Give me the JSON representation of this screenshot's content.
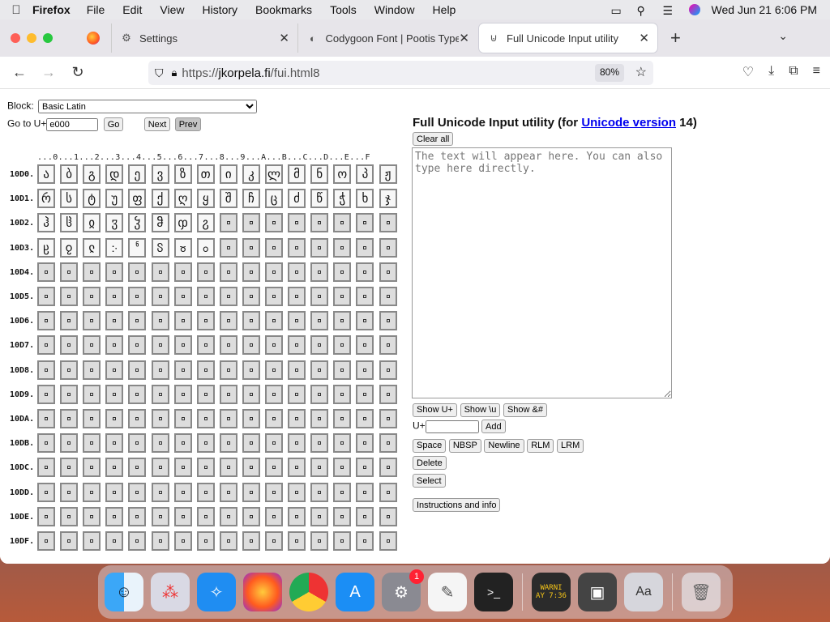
{
  "menubar": {
    "app_name": "Firefox",
    "items": [
      "File",
      "Edit",
      "View",
      "History",
      "Bookmarks",
      "Tools",
      "Window",
      "Help"
    ],
    "clock": "Wed Jun 21  6:06 PM"
  },
  "tabs": [
    {
      "title": "Settings",
      "icon": "gear-icon"
    },
    {
      "title": "Codygoon Font | Pootis Type Co",
      "icon": "codygoon-favicon"
    },
    {
      "title": "Full Unicode Input utility",
      "icon": "page-icon"
    }
  ],
  "urlbar": {
    "prefix": "https://",
    "host": "jkorpela.fi",
    "path": "/fui.html8",
    "zoom": "80%"
  },
  "page": {
    "block_label": "Block:",
    "block_value": "Basic Latin",
    "goto_label": "Go to U+",
    "goto_value": "e000",
    "go_label": "Go",
    "next_label": "Next",
    "prev_label": "Prev",
    "grid_header": "...0...1...2...3...4...5...6...7...8...9...A...B...C...D...E...F",
    "row_labels": [
      "10D0.",
      "10D1.",
      "10D2.",
      "10D3.",
      "10D4.",
      "10D5.",
      "10D6.",
      "10D7.",
      "10D8.",
      "10D9.",
      "10DA.",
      "10DB.",
      "10DC.",
      "10DD.",
      "10DE.",
      "10DF."
    ],
    "glyph_rows": [
      [
        "ა",
        "ბ",
        "გ",
        "დ",
        "ე",
        "ვ",
        "ზ",
        "თ",
        "ი",
        "კ",
        "ლ",
        "მ",
        "ნ",
        "ო",
        "პ",
        "ჟ"
      ],
      [
        "რ",
        "ს",
        "ტ",
        "უ",
        "ფ",
        "ქ",
        "ღ",
        "ყ",
        "შ",
        "ჩ",
        "ც",
        "ძ",
        "წ",
        "ჭ",
        "ხ",
        "ჯ"
      ],
      [
        "ჰ",
        "ჱ",
        "ჲ",
        "ჳ",
        "ჴ",
        "ჵ",
        "ჶ",
        "ჷ",
        "",
        "",
        "",
        "",
        "",
        "",
        "",
        ""
      ],
      [
        "ჸ",
        "ჹ",
        "ჺ",
        "჻",
        "ჼ",
        "ჽ",
        "ჾ",
        "ჿ",
        "",
        "",
        "",
        "",
        "",
        "",
        "",
        ""
      ]
    ],
    "title_prefix": "Full Unicode Input utility (for ",
    "title_link": "Unicode version",
    "title_suffix": " 14)",
    "clear_label": "Clear all",
    "textarea_placeholder": "The text will appear here. You can also type here directly.",
    "show_uplus": "Show U+",
    "show_u": "Show \\u",
    "show_amp": "Show &#",
    "uplus_label": "U+",
    "add_label": "Add",
    "space_label": "Space",
    "nbsp_label": "NBSP",
    "newline_label": "Newline",
    "rlm_label": "RLM",
    "lrm_label": "LRM",
    "delete_label": "Delete",
    "select_label": "Select",
    "instructions_label": "Instructions and info"
  },
  "dock": {
    "apps": [
      "finder-icon",
      "launchpad-icon",
      "safari-icon",
      "firefox-icon",
      "chrome-icon",
      "app-store-icon",
      "system-settings-icon",
      "textedit-icon",
      "terminal-icon",
      "console-icon",
      "screenshot-icon",
      "font-book-icon",
      "trash-icon"
    ],
    "settings_badge": "1",
    "console_text": "WARNI\nAY 7:36"
  }
}
